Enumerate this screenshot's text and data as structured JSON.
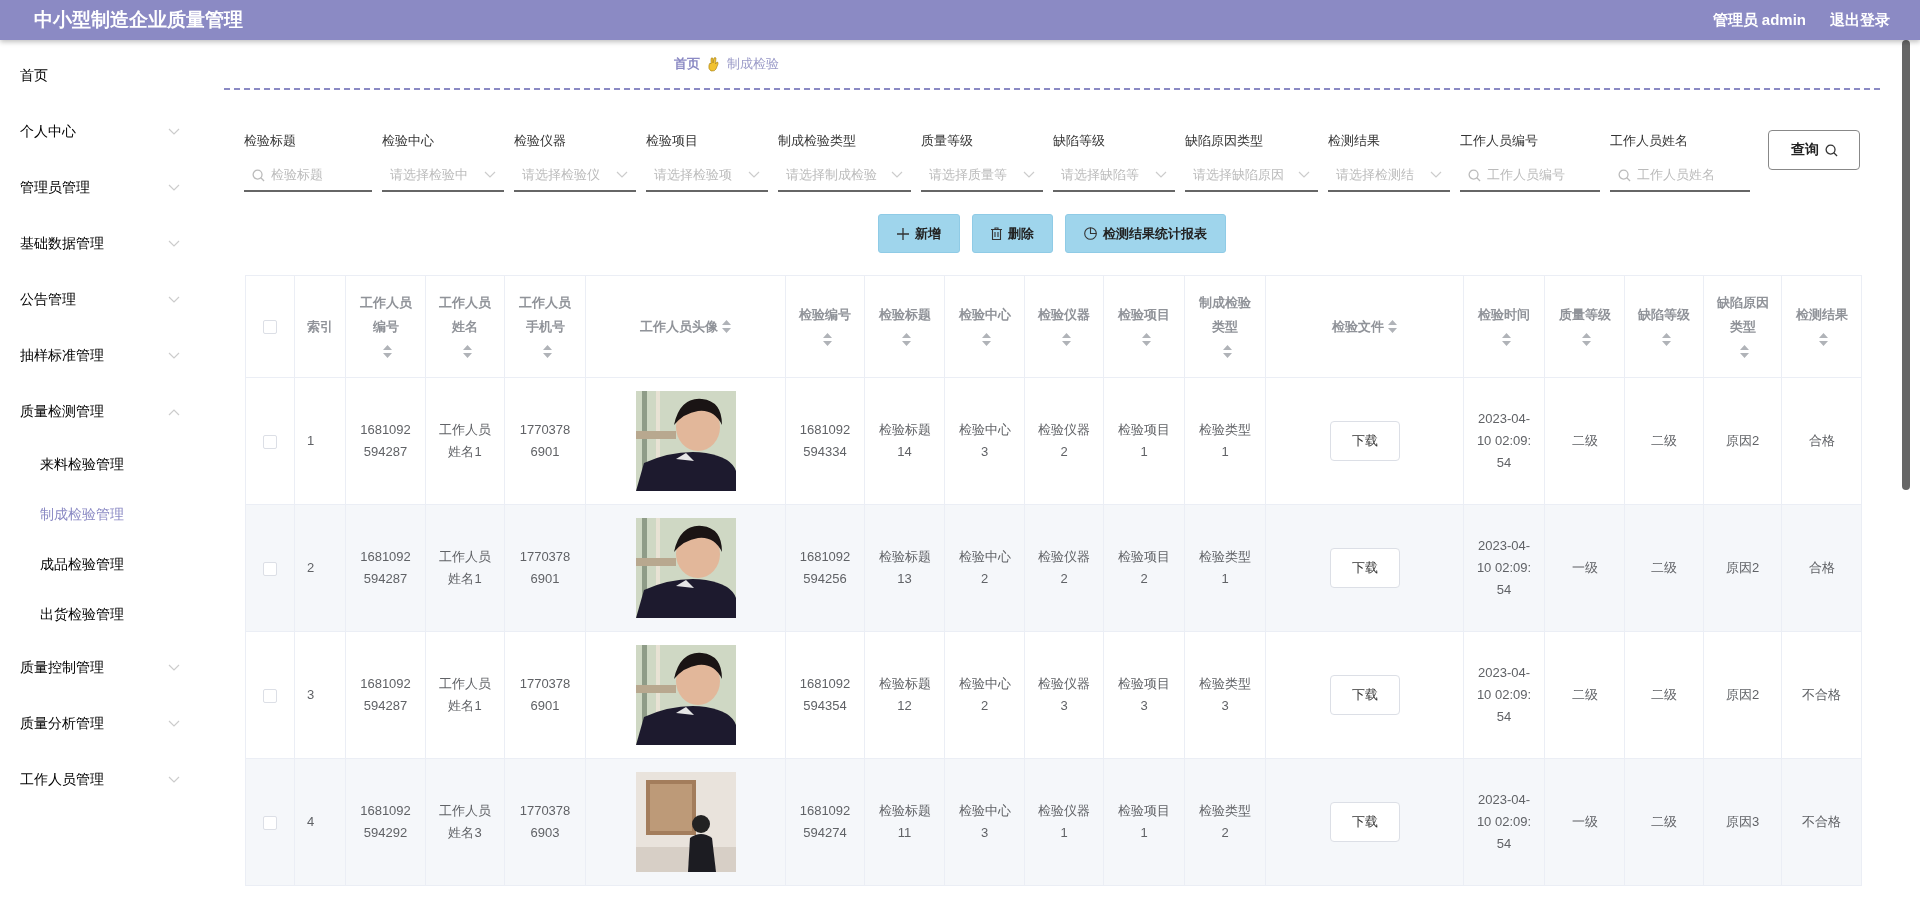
{
  "header": {
    "title": "中小型制造企业质量管理",
    "user": "管理员 admin",
    "logout": "退出登录"
  },
  "sidebar": {
    "items": [
      {
        "label": "首页",
        "kind": "link",
        "selected": false
      },
      {
        "label": "个人中心",
        "kind": "menu",
        "expanded": false,
        "selected": false
      },
      {
        "label": "管理员管理",
        "kind": "menu",
        "expanded": false,
        "selected": false
      },
      {
        "label": "基础数据管理",
        "kind": "menu",
        "expanded": false,
        "selected": false
      },
      {
        "label": "公告管理",
        "kind": "menu",
        "expanded": false,
        "selected": false
      },
      {
        "label": "抽样标准管理",
        "kind": "menu",
        "expanded": false,
        "selected": false
      },
      {
        "label": "质量检测管理",
        "kind": "menu",
        "expanded": true,
        "selected": false,
        "children": [
          {
            "label": "来料检验管理",
            "selected": false
          },
          {
            "label": "制成检验管理",
            "selected": true
          },
          {
            "label": "成品检验管理",
            "selected": false
          },
          {
            "label": "出货检验管理",
            "selected": false
          }
        ]
      },
      {
        "label": "质量控制管理",
        "kind": "menu",
        "expanded": false,
        "selected": false
      },
      {
        "label": "质量分析管理",
        "kind": "menu",
        "expanded": false,
        "selected": false
      },
      {
        "label": "工作人员管理",
        "kind": "menu",
        "expanded": false,
        "selected": false
      }
    ]
  },
  "breadcrumb": {
    "home": "首页",
    "current": "制成检验"
  },
  "filters": [
    {
      "label": "检验标题",
      "kind": "search",
      "placeholder": "检验标题"
    },
    {
      "label": "检验中心",
      "kind": "select",
      "placeholder": "请选择检验中"
    },
    {
      "label": "检验仪器",
      "kind": "select",
      "placeholder": "请选择检验仪"
    },
    {
      "label": "检验项目",
      "kind": "select",
      "placeholder": "请选择检验项"
    },
    {
      "label": "制成检验类型",
      "kind": "select",
      "placeholder": "请选择制成检验"
    },
    {
      "label": "质量等级",
      "kind": "select",
      "placeholder": "请选择质量等"
    },
    {
      "label": "缺陷等级",
      "kind": "select",
      "placeholder": "请选择缺陷等"
    },
    {
      "label": "缺陷原因类型",
      "kind": "select",
      "placeholder": "请选择缺陷原因"
    },
    {
      "label": "检测结果",
      "kind": "select",
      "placeholder": "请选择检测结"
    },
    {
      "label": "工作人员编号",
      "kind": "search",
      "placeholder": "工作人员编号"
    },
    {
      "label": "工作人员姓名",
      "kind": "search",
      "placeholder": "工作人员姓名"
    }
  ],
  "query_button": "查询",
  "actions": [
    {
      "label": "新增",
      "kind": "add"
    },
    {
      "label": "删除",
      "kind": "delete"
    },
    {
      "label": "检测结果统计报表",
      "kind": "report"
    }
  ],
  "table": {
    "select_all_checked": false,
    "columns": [
      {
        "label": "索引",
        "kind": "text",
        "sortable": false
      },
      {
        "label": "工作人员编号",
        "kind": "text",
        "sortable": true
      },
      {
        "label": "工作人员姓名",
        "kind": "text",
        "sortable": true
      },
      {
        "label": "工作人员手机号",
        "kind": "text",
        "sortable": true
      },
      {
        "label": "工作人员头像",
        "kind": "picture",
        "sortable": true
      },
      {
        "label": "检验编号",
        "kind": "text",
        "sortable": true
      },
      {
        "label": "检验标题",
        "kind": "text",
        "sortable": true
      },
      {
        "label": "检验中心",
        "kind": "text",
        "sortable": true
      },
      {
        "label": "检验仪器",
        "kind": "text",
        "sortable": true
      },
      {
        "label": "检验项目",
        "kind": "text",
        "sortable": true
      },
      {
        "label": "制成检验类型",
        "kind": "text",
        "sortable": true
      },
      {
        "label": "检验文件",
        "kind": "button",
        "sortable": true
      },
      {
        "label": "检验时间",
        "kind": "text",
        "sortable": true
      },
      {
        "label": "质量等级",
        "kind": "text",
        "sortable": true
      },
      {
        "label": "缺陷等级",
        "kind": "text",
        "sortable": true
      },
      {
        "label": "缺陷原因类型",
        "kind": "text",
        "sortable": true
      },
      {
        "label": "检测结果",
        "kind": "text",
        "sortable": true
      }
    ],
    "rows": [
      {
        "checked": false,
        "cells": [
          "1",
          "1681092594287",
          "工作人员姓名1",
          "17703786901",
          {
            "kind": "picture"
          },
          "1681092594334",
          "检验标题14",
          "检验中心3",
          "检验仪器2",
          "检验项目1",
          "检验类型1",
          "下载",
          "2023-04-10 02:09:54",
          "二级",
          "二级",
          "原因2",
          "合格"
        ]
      },
      {
        "checked": false,
        "cells": [
          "2",
          "1681092594287",
          "工作人员姓名1",
          "17703786901",
          {
            "kind": "picture"
          },
          "1681092594256",
          "检验标题13",
          "检验中心2",
          "检验仪器2",
          "检验项目2",
          "检验类型1",
          "下载",
          "2023-04-10 02:09:54",
          "一级",
          "二级",
          "原因2",
          "合格"
        ]
      },
      {
        "checked": false,
        "cells": [
          "3",
          "1681092594287",
          "工作人员姓名1",
          "17703786901",
          {
            "kind": "picture"
          },
          "1681092594354",
          "检验标题12",
          "检验中心2",
          "检验仪器3",
          "检验项目3",
          "检验类型3",
          "下载",
          "2023-04-10 02:09:54",
          "二级",
          "二级",
          "原因2",
          "不合格"
        ]
      },
      {
        "checked": false,
        "cells": [
          "4",
          "1681092594292",
          "工作人员姓名3",
          "17703786903",
          {
            "kind": "picture"
          },
          "1681092594274",
          "检验标题11",
          "检验中心3",
          "检验仪器1",
          "检验项目1",
          "检验类型2",
          "下载",
          "2023-04-10 02:09:54",
          "一级",
          "二级",
          "原因3",
          "不合格"
        ]
      }
    ]
  }
}
